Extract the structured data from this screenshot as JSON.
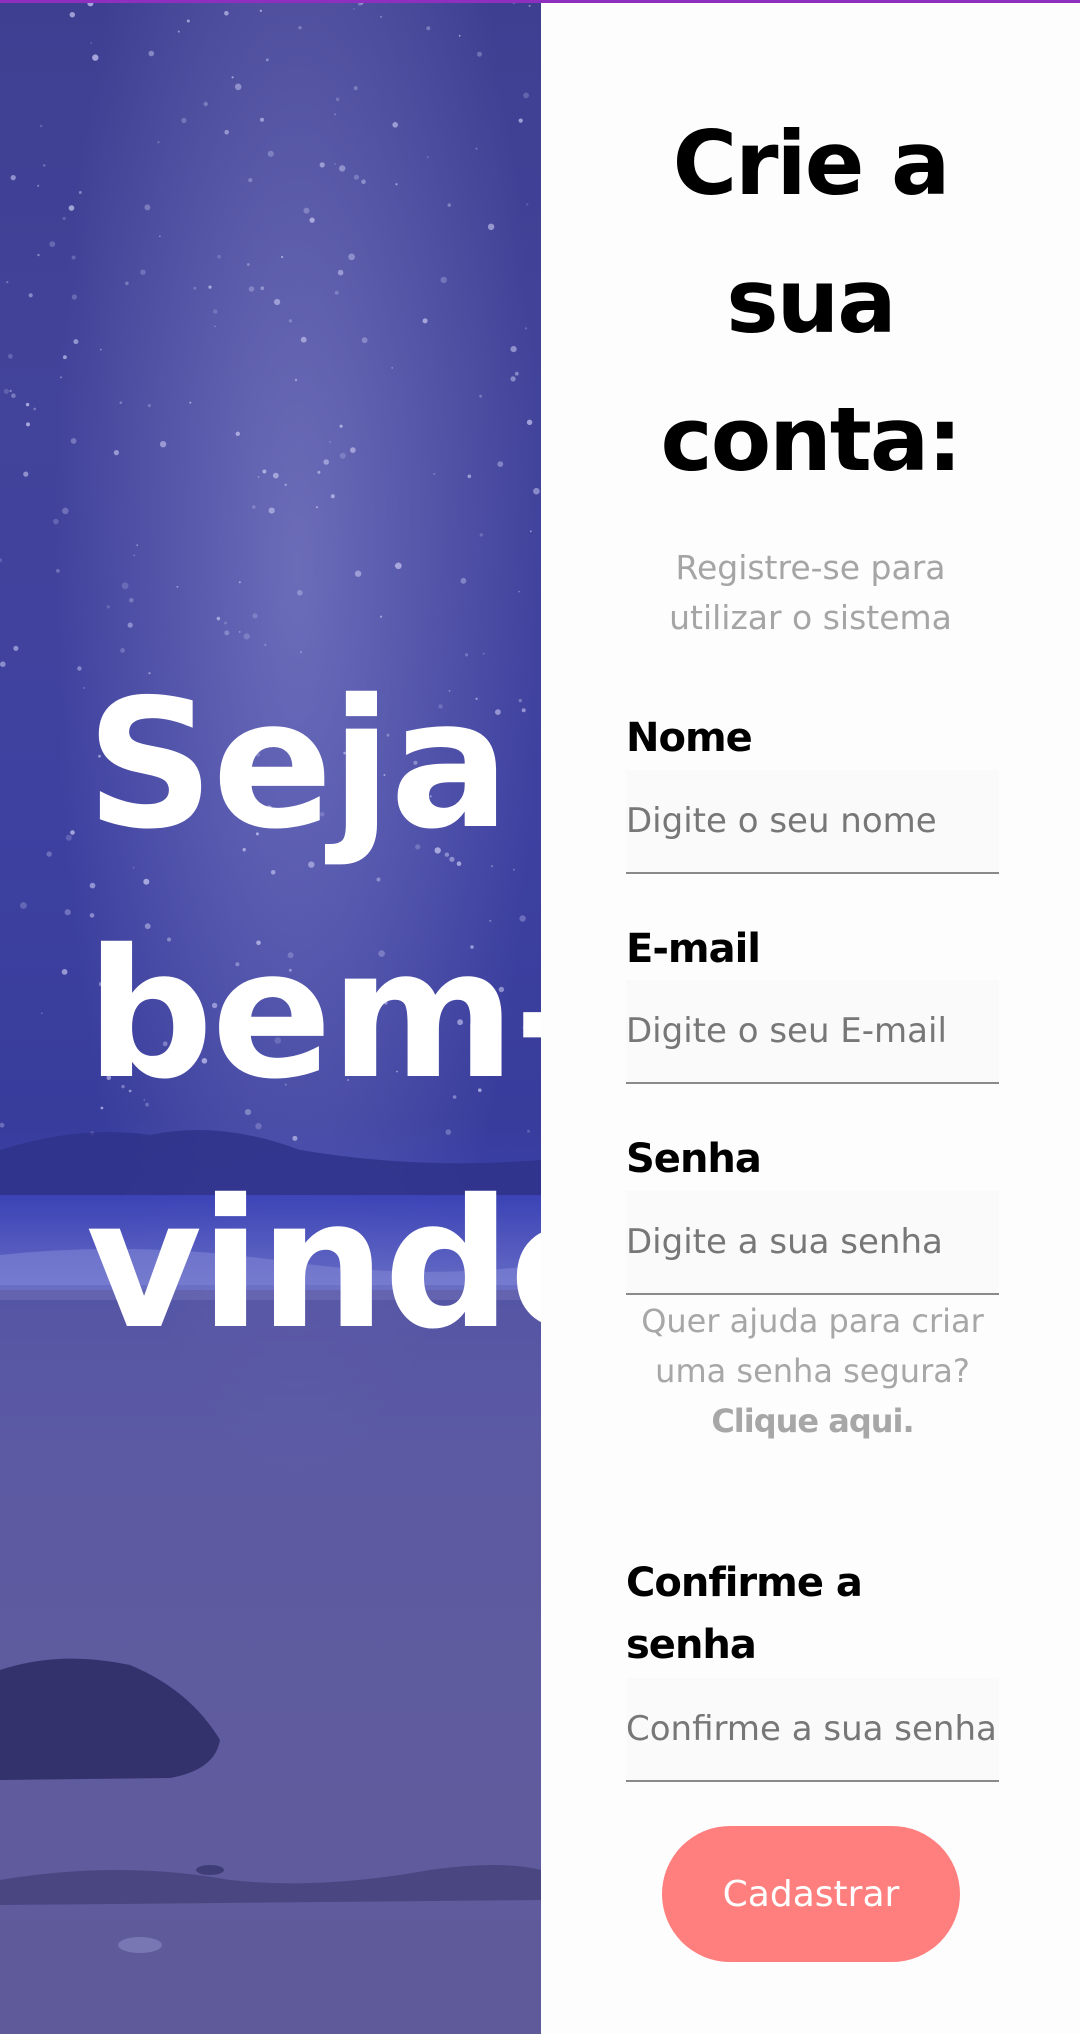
{
  "hero": {
    "title": "Seja\nbem-\nvindo",
    "background_color": "#3f43a0"
  },
  "form": {
    "title": "Crie a\nsua\nconta:",
    "subtitle": "Registre-se para utilizar o sistema",
    "fields": [
      {
        "label": "Nome",
        "placeholder": "Digite o seu nome",
        "value": ""
      },
      {
        "label": "E-mail",
        "placeholder": "Digite o seu E-mail",
        "value": ""
      },
      {
        "label": "Senha",
        "placeholder": "Digite a sua senha",
        "value": ""
      },
      {
        "label": "Confirme a senha",
        "placeholder": "Confirme a sua senha",
        "value": ""
      }
    ],
    "password_help": {
      "text": "Quer ajuda para criar uma senha segura?",
      "link": "Clique aqui."
    },
    "submit_label": "Cadastrar"
  },
  "colors": {
    "accent_top_bar": "#8e2fbf",
    "button": "#ff7f7f",
    "muted_text": "#a5a5a5"
  }
}
